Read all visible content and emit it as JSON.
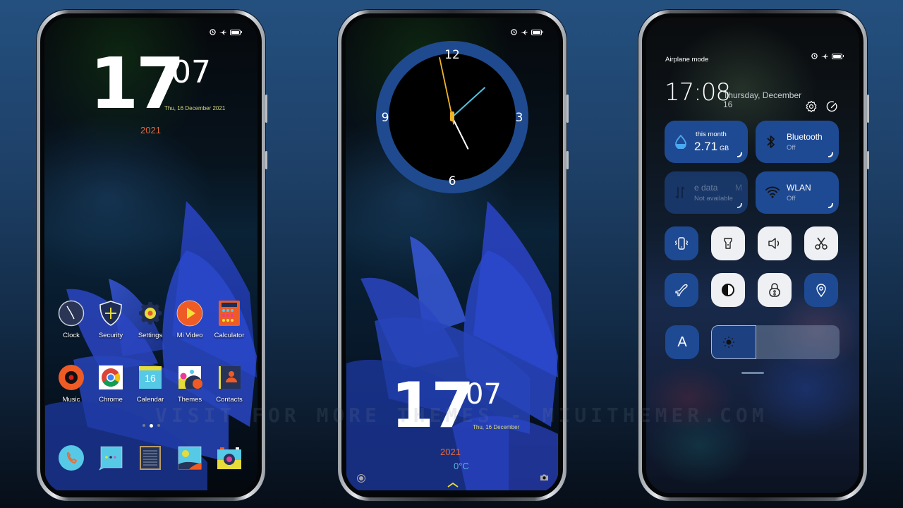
{
  "watermark": "VISIT FOR MORE THEMES - MIUITHEMER.COM",
  "colors": {
    "accent_tile": "#1e4a93",
    "date_yellow": "#d6d77c",
    "year_orange": "#e3673a",
    "temp_blue": "#58b4dd",
    "clock_ring": "#1f4a8f"
  },
  "status_bar": {
    "icons": [
      "alarm-icon",
      "airplane-icon",
      "battery-icon"
    ]
  },
  "home_screen": {
    "clock": {
      "hour": "17",
      "minute": "07"
    },
    "date": "Thu, 16 December 2021",
    "year": "2021",
    "apps_row1": [
      {
        "label": "Clock",
        "icon": "clock-icon"
      },
      {
        "label": "Security",
        "icon": "security-shield-icon"
      },
      {
        "label": "Settings",
        "icon": "settings-gear-icon"
      },
      {
        "label": "Mi Video",
        "icon": "play-icon"
      },
      {
        "label": "Calculator",
        "icon": "calculator-icon"
      }
    ],
    "apps_row2": [
      {
        "label": "Music",
        "icon": "music-record-icon"
      },
      {
        "label": "Chrome",
        "icon": "chrome-icon"
      },
      {
        "label": "Calendar",
        "icon": "calendar-icon",
        "badge": "16"
      },
      {
        "label": "Themes",
        "icon": "themes-icon"
      },
      {
        "label": "Contacts",
        "icon": "contacts-icon"
      }
    ],
    "page_indicator": {
      "pages": 3,
      "current": 2
    },
    "dock": [
      {
        "icon": "phone-icon"
      },
      {
        "icon": "messages-icon"
      },
      {
        "icon": "notes-icon"
      },
      {
        "icon": "gallery-icon"
      },
      {
        "icon": "camera-icon"
      }
    ]
  },
  "lock_screen": {
    "analog_clock": {
      "numerals": {
        "top": "12",
        "right": "3",
        "bottom": "6",
        "left": "9"
      },
      "time": {
        "hour": 17,
        "minute": 7,
        "second": 58
      }
    },
    "clock": {
      "hour": "17",
      "minute": "07"
    },
    "date": "Thu, 16 December",
    "year": "2021",
    "temperature": "0°C"
  },
  "control_center": {
    "status_label": "Airplane mode",
    "time": "17:08",
    "date": "Thursday, December 16",
    "tiles": [
      {
        "id": "data-usage",
        "small": "this month",
        "value": "2.71",
        "unit": "GB"
      },
      {
        "id": "bluetooth",
        "title": "Bluetooth",
        "sub": "Off"
      },
      {
        "id": "mobile-data",
        "title": "e data",
        "title_cut": "M",
        "sub": "Not available"
      },
      {
        "id": "wlan",
        "title": "WLAN",
        "sub": "Off"
      }
    ],
    "toggles_row1": [
      {
        "name": "vibrate",
        "state": "off"
      },
      {
        "name": "flashlight",
        "state": "on"
      },
      {
        "name": "sound",
        "state": "on"
      },
      {
        "name": "screenshot",
        "state": "on"
      }
    ],
    "toggles_row2": [
      {
        "name": "airplane",
        "state": "off"
      },
      {
        "name": "dark-mode",
        "state": "on"
      },
      {
        "name": "lock-screen",
        "state": "on"
      },
      {
        "name": "location",
        "state": "off"
      }
    ],
    "auto_brightness_label": "A",
    "brightness_level": 0.35
  }
}
